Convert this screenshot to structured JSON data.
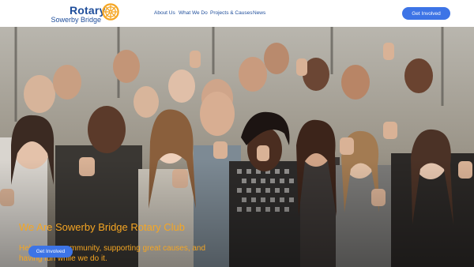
{
  "header": {
    "logo": {
      "wordmark": "Rotary",
      "subtitle": "Sowerby Bridge",
      "emblem_icon": "rotary-wheel-icon",
      "color": "#1f4e9b",
      "emblem_color": "#f5a623"
    },
    "nav": [
      {
        "label": "About Us"
      },
      {
        "label": "What We Do"
      },
      {
        "label": "Projects & Causes"
      },
      {
        "label": "News"
      }
    ],
    "cta_label": "Get Involved"
  },
  "hero": {
    "title": "We Are Sowerby Bridge Rotary Club",
    "subtitle": "Helping our community, supporting great causes, and having fun while we do it.",
    "cta_label": "Get Involved",
    "background_image": "group of smiling people giving thumbs up"
  },
  "colors": {
    "accent": "#3d74e6",
    "heading": "#f5a623",
    "nav_text": "#1f4e9b"
  }
}
